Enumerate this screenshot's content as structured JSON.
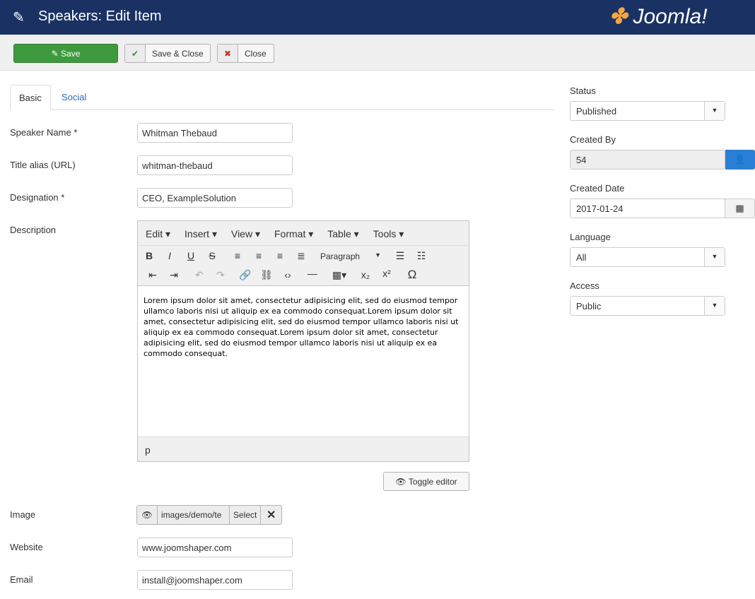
{
  "header": {
    "title": "Speakers: Edit Item",
    "logo": "Joomla!"
  },
  "toolbar": {
    "save": "Save",
    "save_close": "Save & Close",
    "close": "Close"
  },
  "tabs": [
    {
      "label": "Basic"
    },
    {
      "label": "Social"
    }
  ],
  "form": {
    "speaker_name": {
      "label": "Speaker Name *",
      "value": "Whitman Thebaud"
    },
    "alias": {
      "label": "Title alias (URL)",
      "value": "whitman-thebaud"
    },
    "designation": {
      "label": "Designation *",
      "value": "CEO, ExampleSolution"
    },
    "description": {
      "label": "Description"
    },
    "image": {
      "label": "Image",
      "value": "images/demo/te",
      "select": "Select"
    },
    "website": {
      "label": "Website",
      "value": "www.joomshaper.com"
    },
    "email": {
      "label": "Email",
      "value": "install@joomshaper.com"
    }
  },
  "editor": {
    "menus": [
      "Edit",
      "Insert",
      "View",
      "Format",
      "Table",
      "Tools"
    ],
    "format_select": "Paragraph",
    "content": "Lorem ipsum dolor sit amet, consectetur adipisicing elit, sed do eiusmod tempor ullamco laboris nisi ut aliquip ex ea commodo consequat.Lorem ipsum dolor sit amet, consectetur adipisicing elit, sed do eiusmod tempor ullamco laboris nisi ut aliquip ex ea commodo consequat.Lorem ipsum dolor sit amet, consectetur adipisicing elit, sed do eiusmod tempor ullamco laboris nisi ut aliquip ex ea commodo consequat.",
    "path": "p",
    "toggle": "Toggle editor"
  },
  "sidebar": {
    "status": {
      "label": "Status",
      "value": "Published"
    },
    "created_by": {
      "label": "Created By",
      "value": "54"
    },
    "created_date": {
      "label": "Created Date",
      "value": "2017-01-24"
    },
    "language": {
      "label": "Language",
      "value": "All"
    },
    "access": {
      "label": "Access",
      "value": "Public"
    }
  }
}
